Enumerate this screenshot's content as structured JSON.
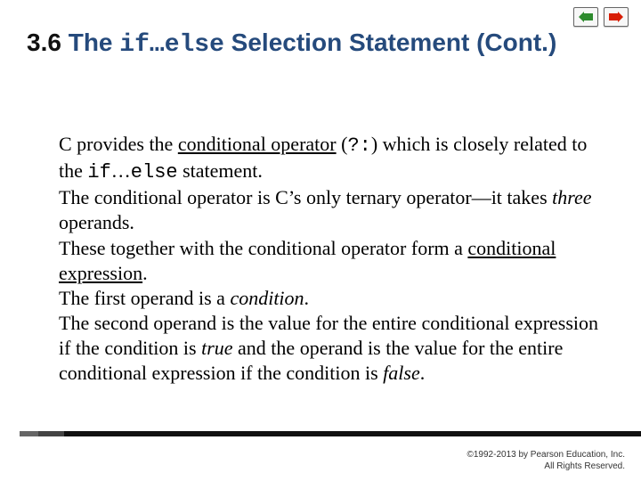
{
  "nav": {
    "prev_icon": "arrow-left",
    "next_icon": "arrow-right",
    "prev_color": "#2e8b2e",
    "next_color": "#d81e05"
  },
  "title": {
    "section_number": "3.6",
    "prefix": "The ",
    "code": "if…else",
    "suffix": " Selection Statement (Cont.)"
  },
  "bullets": [
    {
      "parts": [
        {
          "t": "C provides the "
        },
        {
          "t": "conditional operator",
          "cls": "ul"
        },
        {
          "t": " ("
        },
        {
          "t": "?:",
          "cls": "mono2"
        },
        {
          "t": ") which is closely related to the "
        },
        {
          "t": "if",
          "cls": "mono2"
        },
        {
          "t": "…"
        },
        {
          "t": "else",
          "cls": "mono2"
        },
        {
          "t": " statement."
        }
      ]
    },
    {
      "parts": [
        {
          "t": "The conditional operator is C’s only ternary operator—it takes "
        },
        {
          "t": "three",
          "cls": "it"
        },
        {
          "t": " operands."
        }
      ]
    },
    {
      "parts": [
        {
          "t": "These together with the conditional operator form a "
        },
        {
          "t": "conditional expression",
          "cls": "ul"
        },
        {
          "t": "."
        }
      ]
    },
    {
      "parts": [
        {
          "t": "The first operand is a "
        },
        {
          "t": "condition",
          "cls": "it"
        },
        {
          "t": "."
        }
      ]
    },
    {
      "parts": [
        {
          "t": "The second operand is the value for the entire conditional expression if the condition is "
        },
        {
          "t": "true",
          "cls": "it"
        },
        {
          "t": " and the operand is the value for the entire conditional expression if the condition is "
        },
        {
          "t": "false",
          "cls": "it"
        },
        {
          "t": "."
        }
      ]
    }
  ],
  "copyright": {
    "line1": "©1992-2013 by Pearson Education, Inc.",
    "line2": "All Rights Reserved."
  }
}
